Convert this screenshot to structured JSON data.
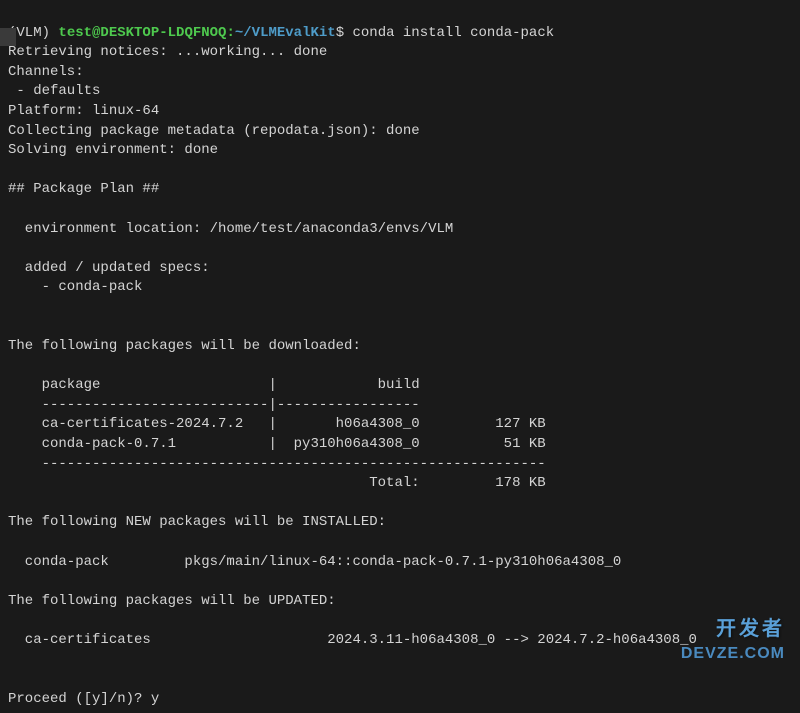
{
  "prompt": {
    "env": "(VLM) ",
    "user_host": "test@DESKTOP-LDQFNOQ",
    "colon": ":",
    "path": "~/VLMEvalKit",
    "dollar": "$ ",
    "command": "conda install conda-pack"
  },
  "output": {
    "line1": "Retrieving notices: ...working... done",
    "line2": "Channels:",
    "line3": " - defaults",
    "line4": "Platform: linux-64",
    "line5": "Collecting package metadata (repodata.json): done",
    "line6": "Solving environment: done",
    "line7": "",
    "line8": "## Package Plan ##",
    "line9": "",
    "line10": "  environment location: /home/test/anaconda3/envs/VLM",
    "line11": "",
    "line12": "  added / updated specs:",
    "line13": "    - conda-pack",
    "line14": "",
    "line15": "",
    "line16": "The following packages will be downloaded:",
    "line17": "",
    "line18": "    package                    |            build",
    "line19": "    ---------------------------|-----------------",
    "line20": "    ca-certificates-2024.7.2   |       h06a4308_0         127 KB",
    "line21": "    conda-pack-0.7.1           |  py310h06a4308_0          51 KB",
    "line22": "    ------------------------------------------------------------",
    "line23": "                                           Total:         178 KB",
    "line24": "",
    "line25": "The following NEW packages will be INSTALLED:",
    "line26": "",
    "line27": "  conda-pack         pkgs/main/linux-64::conda-pack-0.7.1-py310h06a4308_0",
    "line28": "",
    "line29": "The following packages will be UPDATED:",
    "line30": "",
    "line31": "  ca-certificates                     2024.3.11-h06a4308_0 --> 2024.7.2-h06a4308_0",
    "line32": "",
    "line33": "",
    "line34": "Proceed ([y]/n)? y"
  },
  "watermark": {
    "cn": "开发者",
    "en": "DEVZE.COM"
  }
}
